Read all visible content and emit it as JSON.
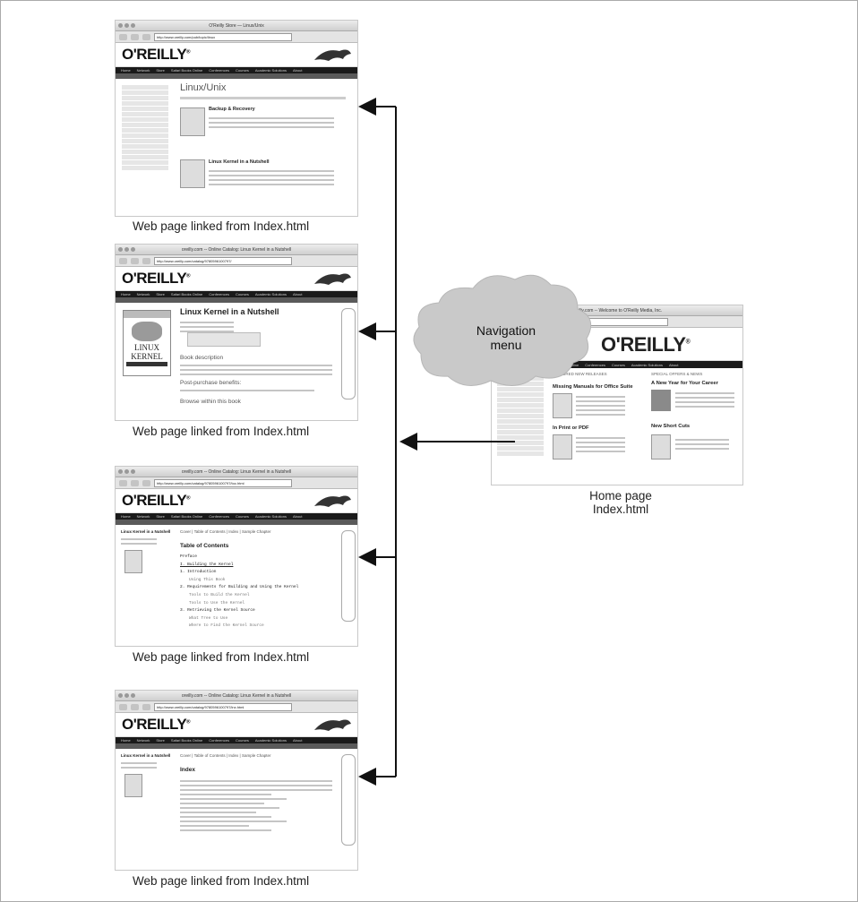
{
  "captions": {
    "linked": "Web page linked from Index.html",
    "home_line1": "Home page",
    "home_line2": "Index.html",
    "cloud_line1": "Navigation",
    "cloud_line2": "menu"
  },
  "logo": "O'REILLY",
  "shot1": {
    "window_title": "O'Reilly Store — Linux/Unix",
    "url": "http://www.oreilly.com/pub/topic/linux",
    "heading": "Linux/Unix",
    "book1_title": "Backup & Recovery",
    "book2_title": "Linux Kernel in a Nutshell"
  },
  "shot2": {
    "window_title": "oreilly.com -- Online Catalog: Linux Kernel in a Nutshell",
    "url": "http://www.oreilly.com/catalog/9780596100797/",
    "heading": "Linux Kernel in a Nutshell",
    "section1": "Book description",
    "section2": "Post-purchase benefits:",
    "section3": "Browse within this book",
    "cover_line1": "LINUX",
    "cover_line2": "KERNEL"
  },
  "shot3": {
    "window_title": "oreilly.com -- Online Catalog: Linux Kernel in a Nutshell",
    "url": "http://www.oreilly.com/catalog/9780596100797/toc.html",
    "side_title": "Linux Kernel in a Nutshell",
    "heading": "Table of Contents",
    "crumbs": "Cover | Table of Contents | Index | Sample Chapter",
    "toc": [
      "Preface",
      "I. Building the Kernel",
      "1. Introduction",
      "Using This Book",
      "2. Requirements for Building and Using the Kernel",
      "Tools to Build the Kernel",
      "Tools to Use the Kernel",
      "3. Retrieving the Kernel Source",
      "What Tree to Use",
      "Where to Find the Kernel Source"
    ]
  },
  "shot4": {
    "window_title": "oreilly.com -- Online Catalog: Linux Kernel in a Nutshell",
    "url": "http://www.oreilly.com/catalog/9780596100797/inx.html",
    "side_title": "Linux Kernel in a Nutshell",
    "heading": "Index",
    "crumbs": "Cover | Table of Contents | Index | Sample Chapter"
  },
  "home": {
    "window_title": "oreilly.com -- Welcome to O'Reilly Media, Inc.",
    "url": "http://www.oreilly.com/index.html",
    "heading": "Missing Manuals for Office Suite",
    "right_heading": "A New Year for Your Career",
    "print_heading": "In Print or PDF",
    "shortcuts_heading": "New Short Cuts",
    "featured": "FEATURED NEW RELEASES",
    "special": "SPECIAL OFFERS & NEWS"
  },
  "nav_items": [
    "Home",
    "Network",
    "Store",
    "Safari Books Online",
    "Conferences",
    "Courses",
    "Academic Solutions",
    "About"
  ],
  "colors": {
    "arrow": "#111111",
    "cloud": "#c9c9c9",
    "nav_bar": "#1a1a1a"
  }
}
